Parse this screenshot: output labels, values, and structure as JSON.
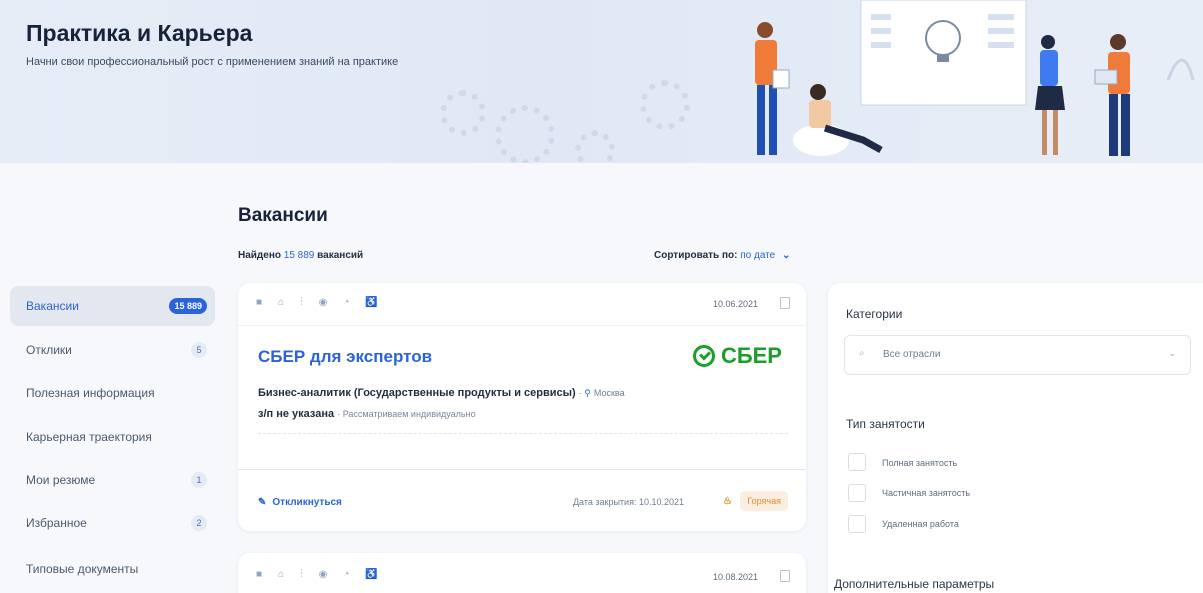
{
  "banner": {
    "title": "Практика и Карьера",
    "subtitle": "Начни свои профессиональный рост с применением знаний на практике"
  },
  "page": {
    "title": "Вакансии",
    "found_prefix": "Найдено ",
    "found_count": "15 889",
    "found_suffix": " вакансий",
    "sort_label": "Сортировать по: ",
    "sort_value": "по дате",
    "sort_chevron": "⌄"
  },
  "sidebar": {
    "items": [
      {
        "label": "Вакансии",
        "count": "15 889",
        "active": true
      },
      {
        "label": "Отклики",
        "count": "5"
      },
      {
        "label": "Полезная информация",
        "count": ""
      },
      {
        "label": "Карьерная траектория",
        "count": ""
      },
      {
        "label": "Мои резюме",
        "count": "1"
      },
      {
        "label": "Избранное",
        "count": "2"
      },
      {
        "label": "Типовые документы",
        "count": ""
      }
    ]
  },
  "cards": [
    {
      "date": "10.06.2021",
      "company": "СБЕР для экспертов",
      "logo_text": "СБЕР",
      "position": "Бизнес-аналитик (Государственные продукты и сервисы)",
      "location": "Москва",
      "salary": "з/п не указана",
      "salary_note": "Рассматриваем индивидуально",
      "respond": "Откликнуться",
      "closing": "Дата закрытия: 10.10.2021",
      "hot": "Горячая"
    },
    {
      "date": "10.08.2021"
    }
  ],
  "filters": {
    "categories_title": "Категории",
    "industry_placeholder": "Все отрасли",
    "employment_title": "Тип занятости",
    "employment_options": [
      "Полная занятость",
      "Частичная занятость",
      "Удаленная работа"
    ],
    "extra_title": "Дополнительные параметры"
  },
  "colors": {
    "accent": "#2a64d6",
    "brand_green": "#1a9f29",
    "hot": "#e28c33"
  }
}
